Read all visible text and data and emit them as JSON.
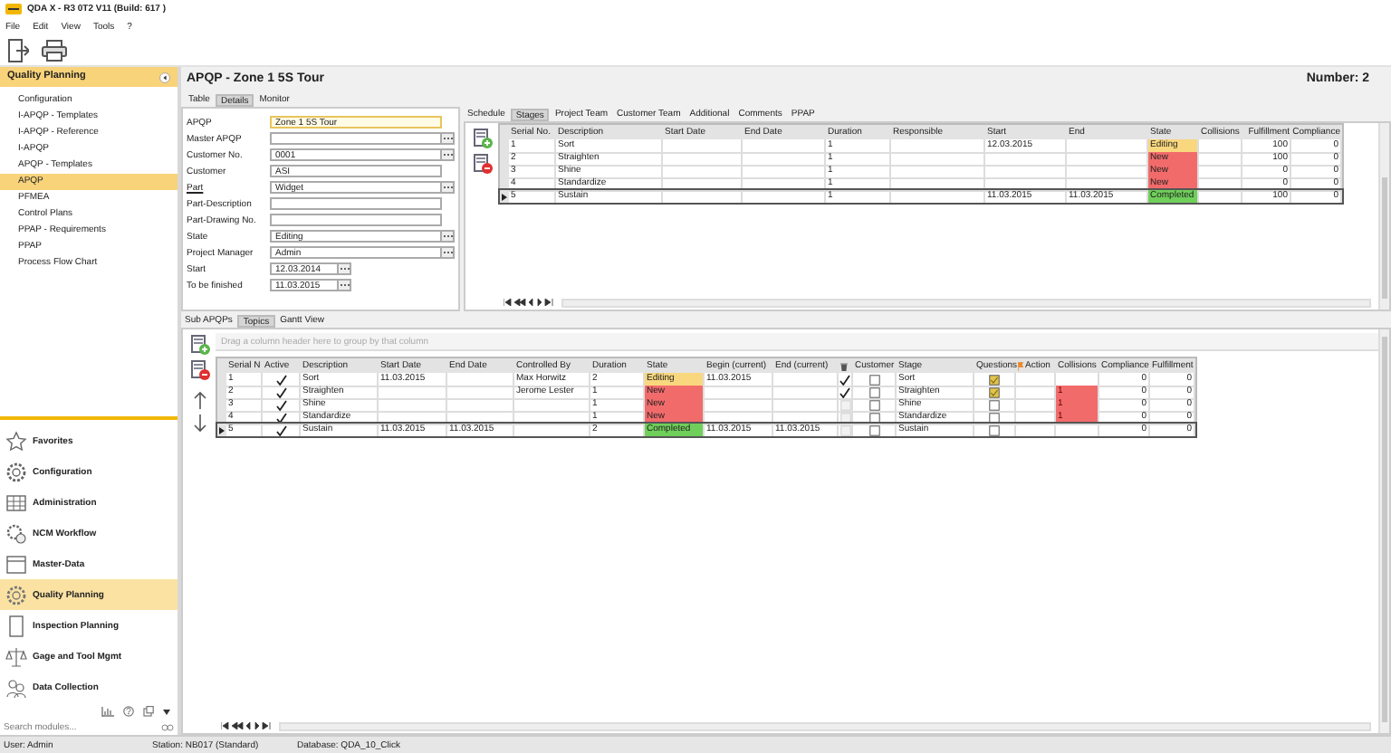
{
  "window": {
    "title": "QDA X - R3 0T2 V11 (Build: 617 )"
  },
  "menu": [
    "File",
    "Edit",
    "View",
    "Tools",
    "?"
  ],
  "sidebar": {
    "header": "Quality Planning",
    "items": [
      {
        "label": "Configuration",
        "selected": false
      },
      {
        "label": "I-APQP - Templates",
        "selected": false
      },
      {
        "label": "I-APQP - Reference",
        "selected": false
      },
      {
        "label": "I-APQP",
        "selected": false
      },
      {
        "label": "APQP - Templates",
        "selected": false
      },
      {
        "label": "APQP",
        "selected": true
      },
      {
        "label": "PFMEA",
        "selected": false
      },
      {
        "label": "Control Plans",
        "selected": false
      },
      {
        "label": "PPAP - Requirements",
        "selected": false
      },
      {
        "label": "PPAP",
        "selected": false
      },
      {
        "label": "Process Flow Chart",
        "selected": false
      }
    ],
    "modules": [
      {
        "label": "Favorites",
        "selected": false
      },
      {
        "label": "Configuration",
        "selected": false
      },
      {
        "label": "Administration",
        "selected": false
      },
      {
        "label": "NCM Workflow",
        "selected": false
      },
      {
        "label": "Master-Data",
        "selected": false
      },
      {
        "label": "Quality Planning",
        "selected": true
      },
      {
        "label": "Inspection Planning",
        "selected": false
      },
      {
        "label": "Gage and Tool Mgmt",
        "selected": false
      },
      {
        "label": "Data Collection",
        "selected": false
      }
    ],
    "search": {
      "placeholder": "Search modules..."
    }
  },
  "record": {
    "title": "APQP - Zone 1 5S Tour",
    "number": "Number: 2"
  },
  "detail_tabs": [
    {
      "label": "Table",
      "selected": false
    },
    {
      "label": "Details",
      "selected": true
    },
    {
      "label": "Monitor",
      "selected": false
    }
  ],
  "form": {
    "fields": [
      {
        "label": "APQP",
        "value": "Zone 1 5S Tour",
        "kind": "text",
        "focused": true,
        "link": false
      },
      {
        "label": "Master APQP",
        "kind": "lookup",
        "focused": false,
        "link": false
      },
      {
        "label": "Customer No.",
        "value": "0001",
        "kind": "lookup",
        "focused": false,
        "link": false
      },
      {
        "label": "Customer",
        "value": "ASI",
        "kind": "text",
        "focused": false,
        "link": false
      },
      {
        "label": "Part",
        "value": "Widget",
        "kind": "lookup",
        "focused": false,
        "link": true
      },
      {
        "label": "Part-Description",
        "kind": "text",
        "focused": false,
        "link": false
      },
      {
        "label": "Part-Drawing No.",
        "kind": "text",
        "focused": false,
        "link": false
      },
      {
        "label": "State",
        "value": "Editing",
        "kind": "lookup",
        "focused": false,
        "link": false
      },
      {
        "label": "Project Manager",
        "value": "Admin",
        "kind": "lookup",
        "focused": false,
        "link": false
      },
      {
        "label": "Start",
        "value": "12.03.2014",
        "kind": "date",
        "focused": false,
        "link": false
      },
      {
        "label": "To be finished",
        "value": "11.03.2015",
        "kind": "date",
        "focused": false,
        "link": false
      }
    ]
  },
  "stage_tabs": [
    {
      "label": "Schedule",
      "selected": false
    },
    {
      "label": "Stages",
      "selected": true
    },
    {
      "label": "Project Team",
      "selected": false
    },
    {
      "label": "Customer Team",
      "selected": false
    },
    {
      "label": "Additional",
      "selected": false
    },
    {
      "label": "Comments",
      "selected": false
    },
    {
      "label": "PPAP",
      "selected": false
    }
  ],
  "stages": {
    "columns": [
      "Serial No.",
      "Description",
      "Start Date",
      "End Date",
      "Duration",
      "Responsible",
      "Start",
      "End",
      "State",
      "Collisions",
      "Fulfillment",
      "Compliance"
    ],
    "rows": [
      {
        "serial": "1",
        "description": "Sort",
        "duration": "1",
        "start": "12.03.2015",
        "state": "Editing",
        "color": "#f9d77e",
        "fulfillment": "100",
        "compliance": "0",
        "selected": false
      },
      {
        "serial": "2",
        "description": "Straighten",
        "duration": "1",
        "state": "New",
        "color": "#f26b6b",
        "fulfillment": "100",
        "compliance": "0",
        "selected": false
      },
      {
        "serial": "3",
        "description": "Shine",
        "duration": "1",
        "state": "New",
        "color": "#f26b6b",
        "fulfillment": "0",
        "compliance": "0",
        "selected": false
      },
      {
        "serial": "4",
        "description": "Standardize",
        "duration": "1",
        "state": "New",
        "color": "#f26b6b",
        "fulfillment": "0",
        "compliance": "0",
        "selected": false
      },
      {
        "serial": "5",
        "description": "Sustain",
        "duration": "1",
        "start": "11.03.2015",
        "end": "11.03.2015",
        "state": "Completed",
        "color": "#6fcf5a",
        "fulfillment": "100",
        "compliance": "0",
        "selected": true
      }
    ]
  },
  "topic_tabs": [
    {
      "label": "Sub APQPs",
      "selected": false
    },
    {
      "label": "Topics",
      "selected": true
    },
    {
      "label": "Gantt View",
      "selected": false
    }
  ],
  "topics": {
    "group_hint": "Drag a column header here to group by that column",
    "columns": [
      {
        "label": "Serial N",
        "kind": "text"
      },
      {
        "label": "Active",
        "kind": "text"
      },
      {
        "label": "Description",
        "kind": "text"
      },
      {
        "label": "Start Date",
        "kind": "text"
      },
      {
        "label": "End Date",
        "kind": "text"
      },
      {
        "label": "Controlled By",
        "kind": "text"
      },
      {
        "label": "Duration",
        "kind": "text"
      },
      {
        "label": "State",
        "kind": "text"
      },
      {
        "label": "Begin (current)",
        "kind": "text"
      },
      {
        "label": "End (current)",
        "kind": "text"
      },
      {
        "kind": "trash"
      },
      {
        "label": "Customer",
        "kind": "text"
      },
      {
        "label": "Stage",
        "kind": "text"
      },
      {
        "label": "Questions",
        "kind": "text"
      },
      {
        "label": "Action",
        "kind": "flag"
      },
      {
        "label": "Collisions",
        "kind": "text"
      },
      {
        "label": "Compliance",
        "kind": "text"
      },
      {
        "label": "Fulfillment",
        "kind": "text"
      }
    ],
    "rows": [
      {
        "serial": "1",
        "active": true,
        "description": "Sort",
        "start_date": "11.03.2015",
        "controlled_by": "Max Horwitz",
        "duration": "2",
        "state": "Editing",
        "color": "#f9d77e",
        "begin_current": "11.03.2015",
        "marked": true,
        "customer": false,
        "stage": "Sort",
        "questions": true,
        "collision": false,
        "compliance": "0",
        "fulfillment": "0",
        "selected": false
      },
      {
        "serial": "2",
        "active": true,
        "description": "Straighten",
        "controlled_by": "Jerome Lester",
        "duration": "1",
        "state": "New",
        "color": "#f26b6b",
        "marked": true,
        "customer": false,
        "stage": "Straighten",
        "questions": true,
        "collisions": "1",
        "collision": true,
        "compliance": "0",
        "fulfillment": "0",
        "selected": false
      },
      {
        "serial": "3",
        "active": true,
        "description": "Shine",
        "duration": "1",
        "state": "New",
        "color": "#f26b6b",
        "marked": false,
        "customer": false,
        "stage": "Shine",
        "questions": false,
        "collisions": "1",
        "collision": true,
        "compliance": "0",
        "fulfillment": "0",
        "selected": false
      },
      {
        "serial": "4",
        "active": true,
        "description": "Standardize",
        "duration": "1",
        "state": "New",
        "color": "#f26b6b",
        "marked": false,
        "customer": false,
        "stage": "Standardize",
        "questions": false,
        "collisions": "1",
        "collision": true,
        "compliance": "0",
        "fulfillment": "0",
        "selected": false
      },
      {
        "serial": "5",
        "active": true,
        "description": "Sustain",
        "start_date": "11.03.2015",
        "end_date": "11.03.2015",
        "duration": "2",
        "state": "Completed",
        "color": "#6fcf5a",
        "begin_current": "11.03.2015",
        "end_current": "11.03.2015",
        "marked": false,
        "customer": false,
        "stage": "Sustain",
        "questions": false,
        "collision": false,
        "compliance": "0",
        "fulfillment": "0",
        "selected": true
      }
    ]
  },
  "status_bar": {
    "user": "User: Admin",
    "station": "Station: NB017 (Standard)",
    "database": "Database: QDA_10_Click"
  }
}
